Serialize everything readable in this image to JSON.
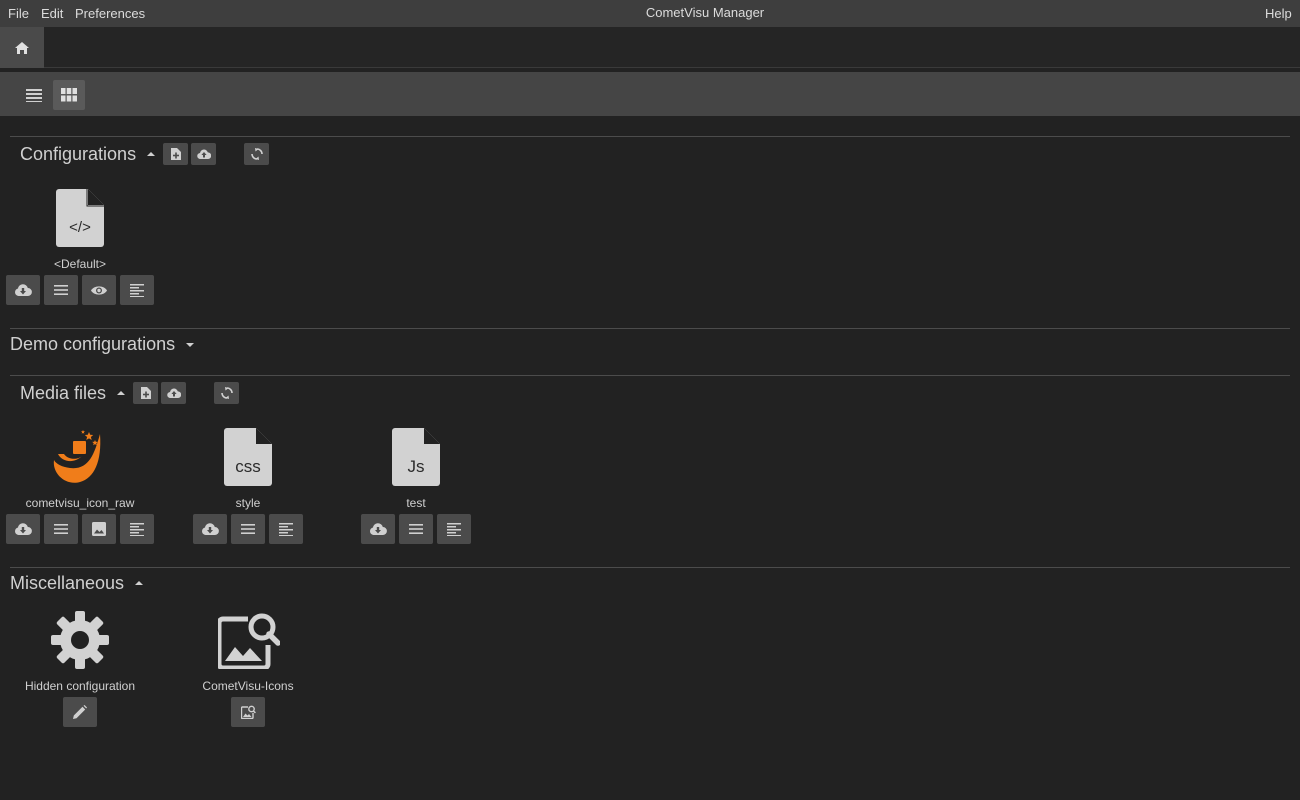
{
  "menubar": {
    "file": "File",
    "edit": "Edit",
    "preferences": "Preferences",
    "title": "CometVisu Manager",
    "help": "Help"
  },
  "sections": {
    "configurations": {
      "title": "Configurations",
      "items": [
        {
          "label": "<Default>",
          "glyph": "</>"
        }
      ]
    },
    "demo": {
      "title": "Demo configurations"
    },
    "media": {
      "title": "Media files",
      "items": [
        {
          "label": "cometvisu_icon_raw"
        },
        {
          "label": "style",
          "glyph": "css"
        },
        {
          "label": "test",
          "glyph": "Js"
        }
      ]
    },
    "misc": {
      "title": "Miscellaneous",
      "items": [
        {
          "label": "Hidden configuration"
        },
        {
          "label": "CometVisu-Icons"
        }
      ]
    }
  },
  "colors": {
    "background": "#222222",
    "menubar": "#3e3e3e",
    "toolbar": "#454545",
    "button": "#4b4b4b",
    "icon": "#d2d2d2",
    "logo_orange": "#f07d1a"
  }
}
